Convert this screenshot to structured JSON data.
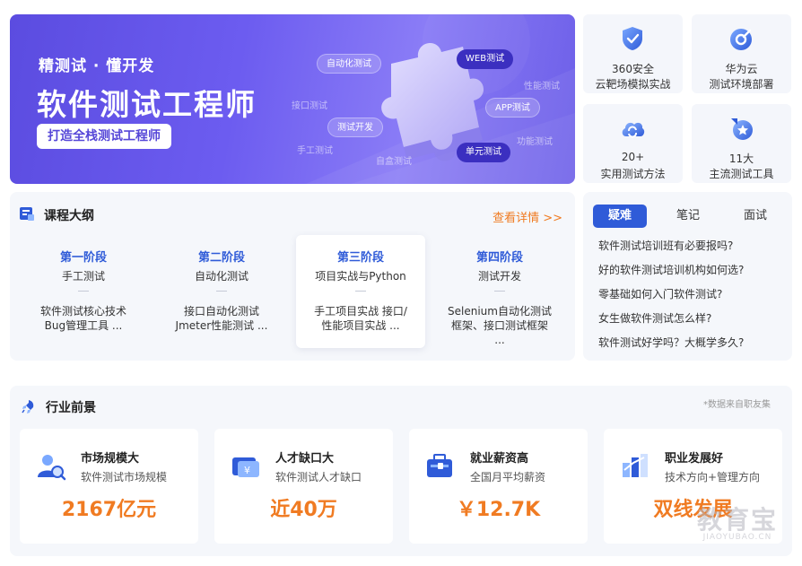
{
  "hero": {
    "subtitle": "精测试 · 懂开发",
    "title": "软件测试工程师",
    "pill": "打造全栈测试工程师",
    "tags": [
      "自动化测试",
      "WEB测试",
      "性能测试",
      "接口测试",
      "APP测试",
      "测试开发",
      "手工测试",
      "功能测试",
      "自盒测试",
      "单元测试"
    ]
  },
  "tiles": [
    {
      "icon": "shield-icon",
      "line1": "360安全",
      "line2": "云靶场模拟实战"
    },
    {
      "icon": "cloud-compass-icon",
      "line1": "华为云",
      "line2": "测试环境部署"
    },
    {
      "icon": "cloud-sync-icon",
      "line1": "20+",
      "line2": "实用测试方法"
    },
    {
      "icon": "star-badge-icon",
      "line1": "11大",
      "line2": "主流测试工具"
    }
  ],
  "outline": {
    "title": "课程大纲",
    "more": "查看详情 >>",
    "stages": [
      {
        "name": "第一阶段",
        "topic": "手工测试",
        "desc1": "软件测试核心技术",
        "desc2": "Bug管理工具 ..."
      },
      {
        "name": "第二阶段",
        "topic": "自动化测试",
        "desc1": "接口自动化测试",
        "desc2": "Jmeter性能测试 ..."
      },
      {
        "name": "第三阶段",
        "topic": "项目实战与Python",
        "desc1": "手工项目实战 接口/",
        "desc2": "性能项目实战 ..."
      },
      {
        "name": "第四阶段",
        "topic": "测试开发",
        "desc1": "Selenium自动化测试",
        "desc2": "框架、接口测试框架",
        "desc3": "..."
      }
    ]
  },
  "faq": {
    "tabs": [
      "疑难",
      "笔记",
      "面试"
    ],
    "items": [
      "软件测试培训班有必要报吗?",
      "好的软件测试培训机构如何选?",
      "零基础如何入门软件测试?",
      "女生做软件测试怎么样?",
      "软件测试好学吗？大概学多久?"
    ]
  },
  "outlook": {
    "title": "行业前景",
    "note": "*数据来自职友集",
    "cards": [
      {
        "icon": "market-search-icon",
        "title": "市场规模大",
        "sub": "软件测试市场规模",
        "value": "2167亿元"
      },
      {
        "icon": "talent-card-icon",
        "title": "人才缺口大",
        "sub": "软件测试人才缺口",
        "value": "近40万"
      },
      {
        "icon": "salary-briefcase-icon",
        "title": "就业薪资高",
        "sub": "全国月平均薪资",
        "value": "￥12.7K"
      },
      {
        "icon": "career-growth-icon",
        "title": "职业发展好",
        "sub": "技术方向+管理方向",
        "value": "双线发展"
      }
    ]
  },
  "watermark": {
    "big": "教育宝",
    "small": "JIAOYUBAO.CN"
  }
}
